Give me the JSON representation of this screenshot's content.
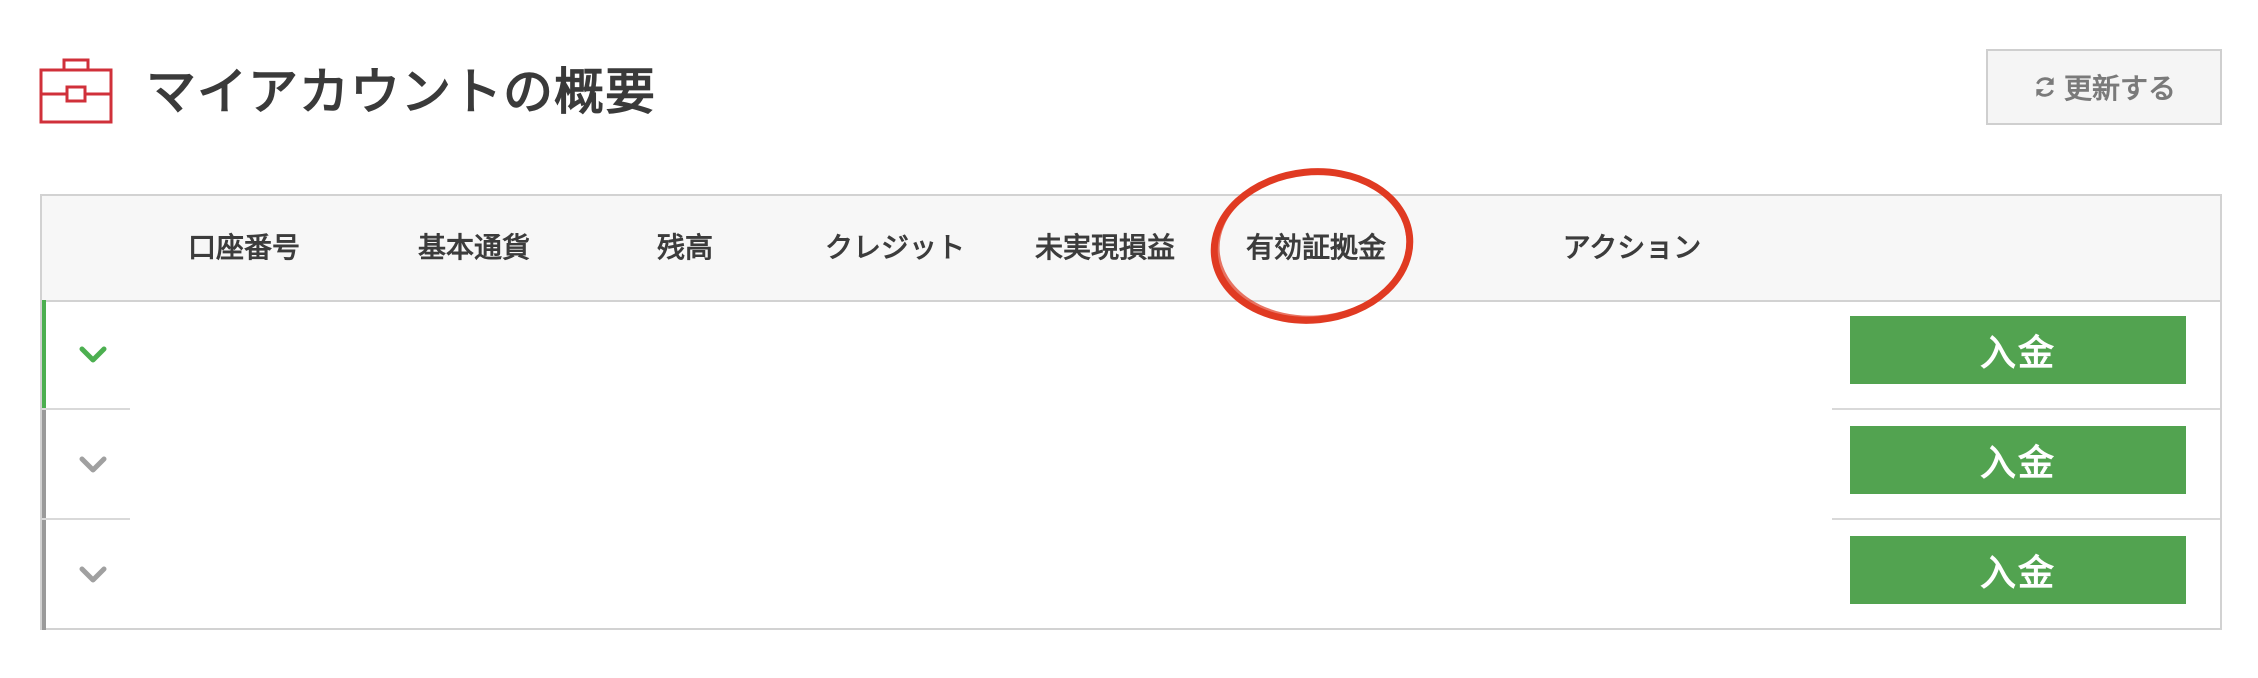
{
  "header": {
    "title": "マイアカウントの概要",
    "title_icon": "briefcase-icon",
    "refresh_label": "更新する",
    "refresh_icon": "refresh-icon"
  },
  "table": {
    "columns": [
      "口座番号",
      "基本通貨",
      "残高",
      "クレジット",
      "未実現損益",
      "有効証拠金",
      "アクション"
    ],
    "rows": [
      {
        "expanded": true,
        "action_label": "入金"
      },
      {
        "expanded": false,
        "action_label": "入金"
      },
      {
        "expanded": false,
        "action_label": "入金"
      }
    ]
  },
  "colors": {
    "brand_red": "#d0303a",
    "accent_green": "#52a350",
    "annotation_red": "#e03a22"
  }
}
